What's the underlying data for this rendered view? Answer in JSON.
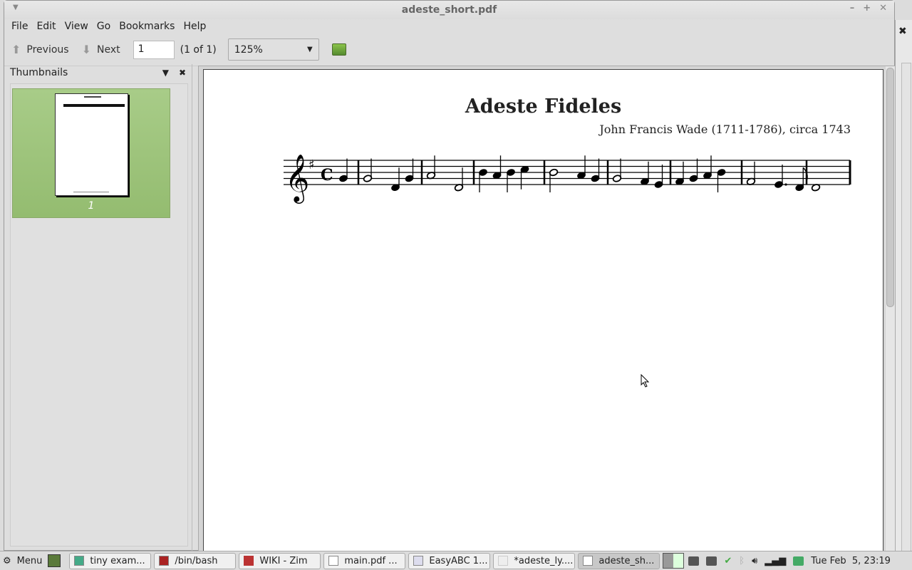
{
  "window": {
    "title": "adeste_short.pdf"
  },
  "menu": [
    "File",
    "Edit",
    "View",
    "Go",
    "Bookmarks",
    "Help"
  ],
  "toolbar": {
    "previous": "Previous",
    "next": "Next",
    "page_value": "1",
    "page_of": "(1 of 1)",
    "zoom": "125%"
  },
  "sidebar": {
    "title": "Thumbnails",
    "thumb_label": "1"
  },
  "document": {
    "title": "Adeste Fideles",
    "composer": "John Francis Wade (1711-1786), circa 1743",
    "key": "G major",
    "time": "C",
    "measures": [
      [
        {
          "p": 2,
          "d": 1,
          "b": 0
        }
      ],
      [
        {
          "p": 2,
          "d": 2,
          "b": 0
        },
        {
          "p": -1,
          "d": 1,
          "b": 2
        },
        {
          "p": 2,
          "d": 1,
          "b": 3
        }
      ],
      [
        {
          "p": 3,
          "d": 2,
          "b": 0
        },
        {
          "p": -1,
          "d": 2,
          "b": 2
        }
      ],
      [
        {
          "p": 4,
          "d": 1,
          "b": 0
        },
        {
          "p": 3,
          "d": 1,
          "b": 1
        },
        {
          "p": 4,
          "d": 1,
          "b": 2
        },
        {
          "p": 5,
          "d": 1,
          "b": 3
        }
      ],
      [
        {
          "p": 4,
          "d": 2,
          "b": 0
        },
        {
          "p": 3,
          "d": 1,
          "b": 2
        },
        {
          "p": 2,
          "d": 1,
          "b": 3
        }
      ],
      [
        {
          "p": 2,
          "d": 2,
          "b": 0
        },
        {
          "p": 1,
          "d": 1,
          "b": 2
        },
        {
          "p": 0,
          "d": 1,
          "b": 3
        }
      ],
      [
        {
          "p": 1,
          "d": 1,
          "b": 0
        },
        {
          "p": 2,
          "d": 1,
          "b": 1
        },
        {
          "p": 3,
          "d": 1,
          "b": 2
        },
        {
          "p": 4,
          "d": 1,
          "b": 3
        }
      ],
      [
        {
          "p": 1,
          "d": 2,
          "b": 0
        },
        {
          "p": 0,
          "d": 1.5,
          "b": 2
        },
        {
          "p": -1,
          "d": 0.5,
          "b": 3.5
        }
      ],
      [
        {
          "p": -1,
          "d": 4,
          "b": 0
        }
      ]
    ]
  },
  "taskbar": {
    "menu": "Menu",
    "items": [
      "tiny exam...",
      "/bin/bash",
      "WIKI - Zim",
      "main.pdf ...",
      "EasyABC 1...",
      "*adeste_ly....",
      "adeste_sh..."
    ],
    "clock": "Tue Feb  5, 23:19"
  }
}
